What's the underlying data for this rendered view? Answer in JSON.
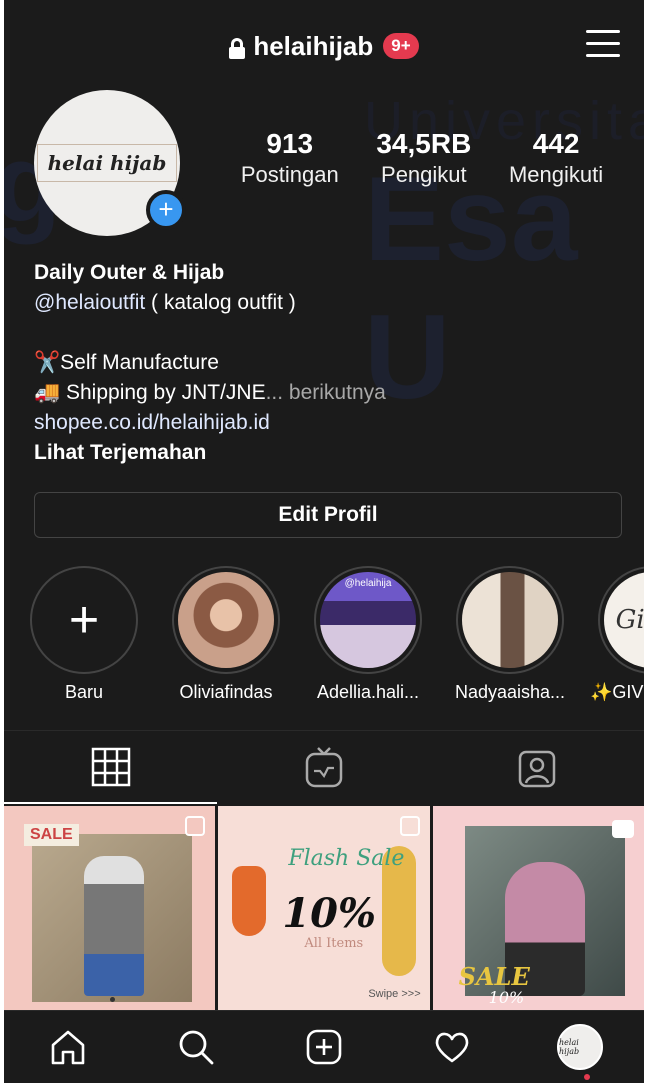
{
  "header": {
    "username": "helaihijab",
    "badge": "9+"
  },
  "profile": {
    "avatar_text": "helai hijab",
    "stats": [
      {
        "value": "913",
        "label": "Postingan"
      },
      {
        "value": "34,5RB",
        "label": "Pengikut"
      },
      {
        "value": "442",
        "label": "Mengikuti"
      }
    ]
  },
  "bio": {
    "name": "Daily Outer & Hijab",
    "mention": "@helaioutfit",
    "mention_suffix": " ( katalog outfit )",
    "line1_emoji": "✂️",
    "line1": "Self Manufacture",
    "line2_emoji": "🚚",
    "line2": " Shipping by JNT/JNE",
    "more": "... berikutnya",
    "link": "shopee.co.id/helaihijab.id",
    "translate": "Lihat Terjemahan"
  },
  "edit_profile": "Edit Profil",
  "highlights": [
    {
      "label": "Baru"
    },
    {
      "label": "Oliviafindas"
    },
    {
      "label": "Adellia.hali..."
    },
    {
      "label": "Nadyaaisha..."
    },
    {
      "label": "✨GIV"
    }
  ],
  "highlight_text": {
    "pic2_tag": "@helaihija",
    "pic4_text": "Gi An"
  },
  "posts": [
    {
      "tag": "SALE"
    },
    {
      "title": "Flash Sale",
      "value": "10%",
      "sub": "All Items",
      "swipe": "Swipe >>>"
    },
    {
      "tag": "SALE",
      "value": "10%"
    }
  ],
  "nav_avatar_text": "helai hijab"
}
